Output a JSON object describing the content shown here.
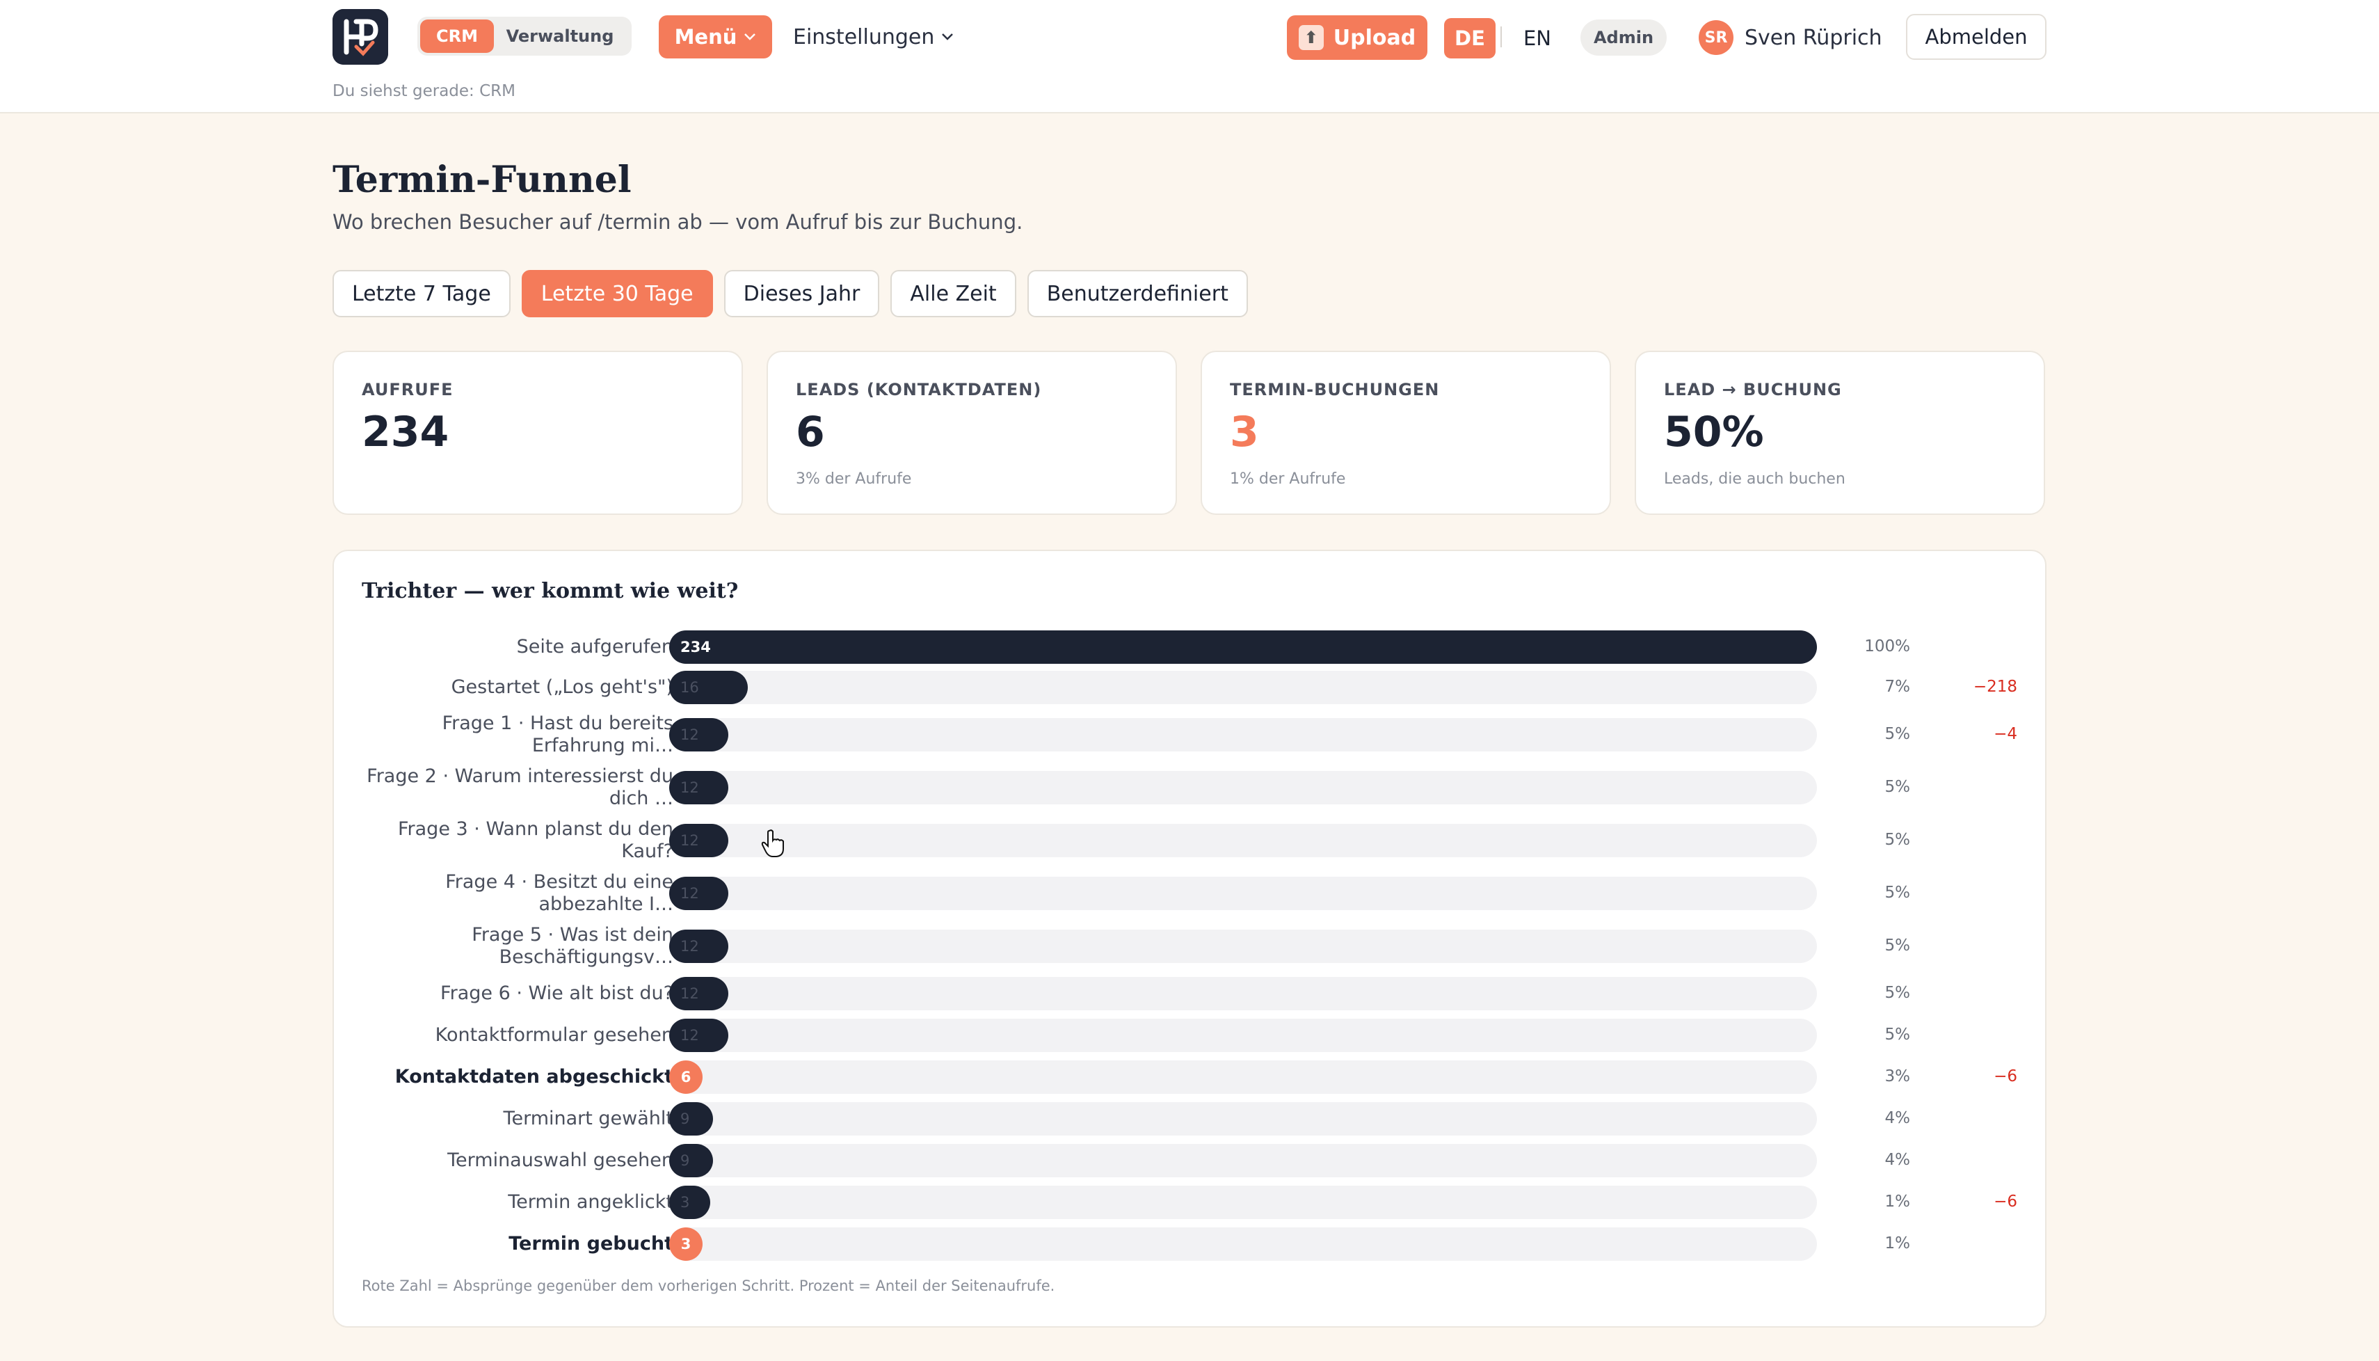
{
  "header": {
    "seg_crm": "CRM",
    "seg_admin": "Verwaltung",
    "menu_label": "Menü",
    "settings_label": "Einstellungen",
    "upload_label": "Upload",
    "lang_de": "DE",
    "lang_en": "EN",
    "role_badge": "Admin",
    "user_initials": "SR",
    "user_name": "Sven Rüprich",
    "logout_label": "Abmelden",
    "context_note": "Du siehst gerade: CRM"
  },
  "page": {
    "title": "Termin-Funnel",
    "subtitle": "Wo brechen Besucher auf /termin ab — vom Aufruf bis zur Buchung."
  },
  "filters": [
    "Letzte 7 Tage",
    "Letzte 30 Tage",
    "Dieses Jahr",
    "Alle Zeit",
    "Benutzerdefiniert"
  ],
  "active_filter": "Letzte 30 Tage",
  "kpis": [
    {
      "label": "AUFRUFE",
      "value": "234",
      "sub": ""
    },
    {
      "label": "LEADS (KONTAKTDATEN)",
      "value": "6",
      "sub": "3% der Aufrufe"
    },
    {
      "label": "TERMIN-BUCHUNGEN",
      "value": "3",
      "sub": "1% der Aufrufe"
    },
    {
      "label": "LEAD → BUCHUNG",
      "value": "50%",
      "sub": "Leads, die auch buchen"
    }
  ],
  "colors": {
    "accent": "#f47b5a",
    "dark": "#1c2333",
    "drop": "#d92d20"
  },
  "funnel": {
    "title": "Trichter — wer kommt wie weit?",
    "footnote": "Rote Zahl = Absprünge gegenüber dem vorherigen Schritt. Prozent = Anteil der Seitenaufrufe.",
    "steps": [
      {
        "label": "Seite aufgerufen",
        "count": 234,
        "count_label": "234",
        "pct": "100%",
        "drop": "",
        "highlight": false
      },
      {
        "label": "Gestartet („Los geht's\")",
        "count": 16,
        "count_label": "16",
        "pct": "7%",
        "drop": "−218",
        "highlight": false
      },
      {
        "label": "Frage 1 · Hast du bereits Erfahrung mi…",
        "count": 12,
        "count_label": "12",
        "pct": "5%",
        "drop": "−4",
        "highlight": false
      },
      {
        "label": "Frage 2 · Warum interessierst du dich …",
        "count": 12,
        "count_label": "12",
        "pct": "5%",
        "drop": "",
        "highlight": false
      },
      {
        "label": "Frage 3 · Wann planst du den Kauf?",
        "count": 12,
        "count_label": "12",
        "pct": "5%",
        "drop": "",
        "highlight": false
      },
      {
        "label": "Frage 4 · Besitzt du eine abbezahlte I…",
        "count": 12,
        "count_label": "12",
        "pct": "5%",
        "drop": "",
        "highlight": false
      },
      {
        "label": "Frage 5 · Was ist dein Beschäftigungsv…",
        "count": 12,
        "count_label": "12",
        "pct": "5%",
        "drop": "",
        "highlight": false
      },
      {
        "label": "Frage 6 · Wie alt bist du?",
        "count": 12,
        "count_label": "12",
        "pct": "5%",
        "drop": "",
        "highlight": false
      },
      {
        "label": "Kontaktformular gesehen",
        "count": 12,
        "count_label": "12",
        "pct": "5%",
        "drop": "",
        "highlight": false
      },
      {
        "label": "Kontaktdaten abgeschickt",
        "count": 6,
        "count_label": "6",
        "pct": "3%",
        "drop": "−6",
        "highlight": true
      },
      {
        "label": "Terminart gewählt",
        "count": 9,
        "count_label": "9",
        "pct": "4%",
        "drop": "",
        "highlight": false
      },
      {
        "label": "Terminauswahl gesehen",
        "count": 9,
        "count_label": "9",
        "pct": "4%",
        "drop": "",
        "highlight": false
      },
      {
        "label": "Termin angeklickt",
        "count": 3,
        "count_label": "3",
        "pct": "1%",
        "drop": "−6",
        "highlight": false
      },
      {
        "label": "Termin gebucht",
        "count": 3,
        "count_label": "3",
        "pct": "1%",
        "drop": "",
        "highlight": true
      }
    ]
  }
}
